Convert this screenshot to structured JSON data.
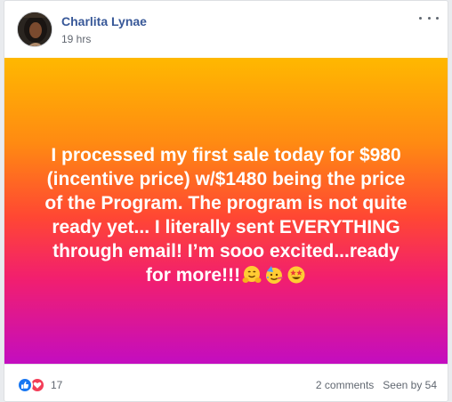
{
  "post": {
    "author": "Charlita Lynae",
    "timestamp": "19 hrs",
    "text": "I processed my first sale today for $980 (incentive price) w/$1480 being the price of the Program. The program is not quite ready yet... I literally sent EVERYTHING through email! I’m sooo excited...ready for more!!!",
    "emojis": [
      "hugging-face",
      "partying-face",
      "star-struck"
    ],
    "background_gradient": [
      "#ffb800",
      "#ff8a12",
      "#ff4733",
      "#f21f6e",
      "#c30dc0"
    ]
  },
  "footer": {
    "reaction_count": "17",
    "reaction_icons": [
      "like-icon",
      "love-icon"
    ],
    "comments_label": "2 comments",
    "seen_label": "Seen by 54"
  },
  "colors": {
    "author_link": "#385898",
    "like": "#1877f2",
    "love": "#f33e58"
  }
}
